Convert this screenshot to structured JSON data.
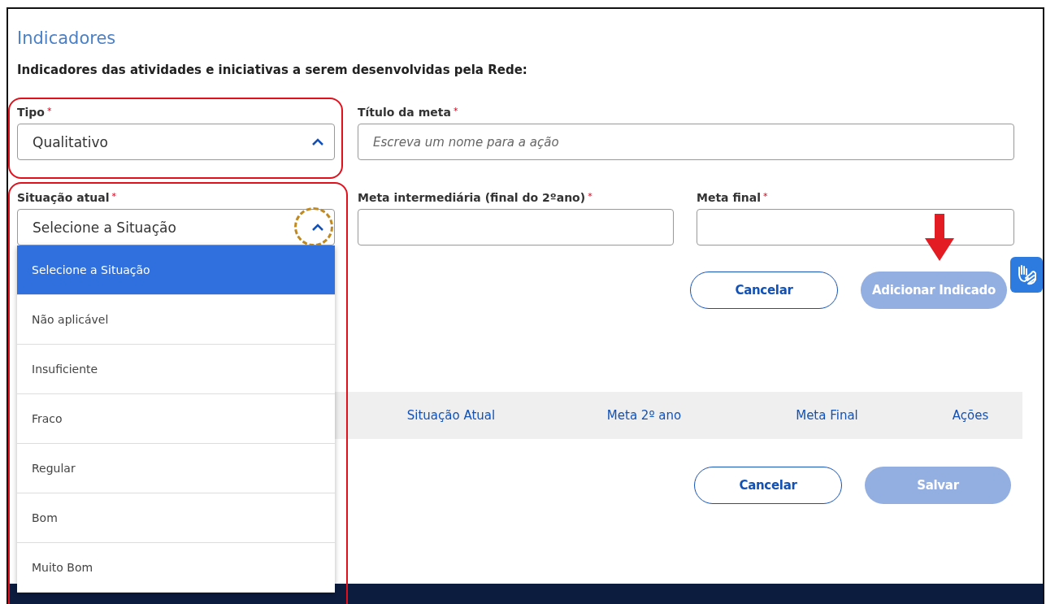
{
  "section_title": "Indicadores",
  "subtitle": "Indicadores das atividades e iniciativas a serem desenvolvidas pela Rede:",
  "tipo": {
    "label": "Tipo",
    "required_mark": "*",
    "value": "Qualitativo",
    "expanded": false
  },
  "titulo_meta": {
    "label": "Título da meta",
    "required_mark": "*",
    "placeholder": "Escreva um nome para a ação"
  },
  "situacao": {
    "label": "Situação atual",
    "required_mark": "*",
    "value": "Selecione a Situação",
    "expanded": true,
    "options": [
      {
        "label": "Selecione a Situação",
        "selected": true
      },
      {
        "label": "Não aplicável",
        "selected": false
      },
      {
        "label": "Insuficiente",
        "selected": false
      },
      {
        "label": "Fraco",
        "selected": false
      },
      {
        "label": "Regular",
        "selected": false
      },
      {
        "label": "Bom",
        "selected": false
      },
      {
        "label": "Muito Bom",
        "selected": false
      }
    ]
  },
  "meta_intermediaria": {
    "label": "Meta intermediária (final do 2ºano)",
    "required_mark": "*"
  },
  "meta_final": {
    "label": "Meta final",
    "required_mark": "*"
  },
  "indicator_buttons": [
    {
      "label": "Cancelar",
      "kind": "secondary",
      "disabled": false
    },
    {
      "label": "Adicionar Indicado",
      "kind": "primary",
      "disabled": true
    }
  ],
  "table": {
    "columns": [
      "Situação Atual",
      "Meta 2º ano",
      "Meta Final",
      "Ações"
    ]
  },
  "form_buttons": [
    {
      "label": "Cancelar",
      "kind": "secondary",
      "disabled": false
    },
    {
      "label": "Salvar",
      "kind": "primary",
      "disabled": true
    }
  ]
}
